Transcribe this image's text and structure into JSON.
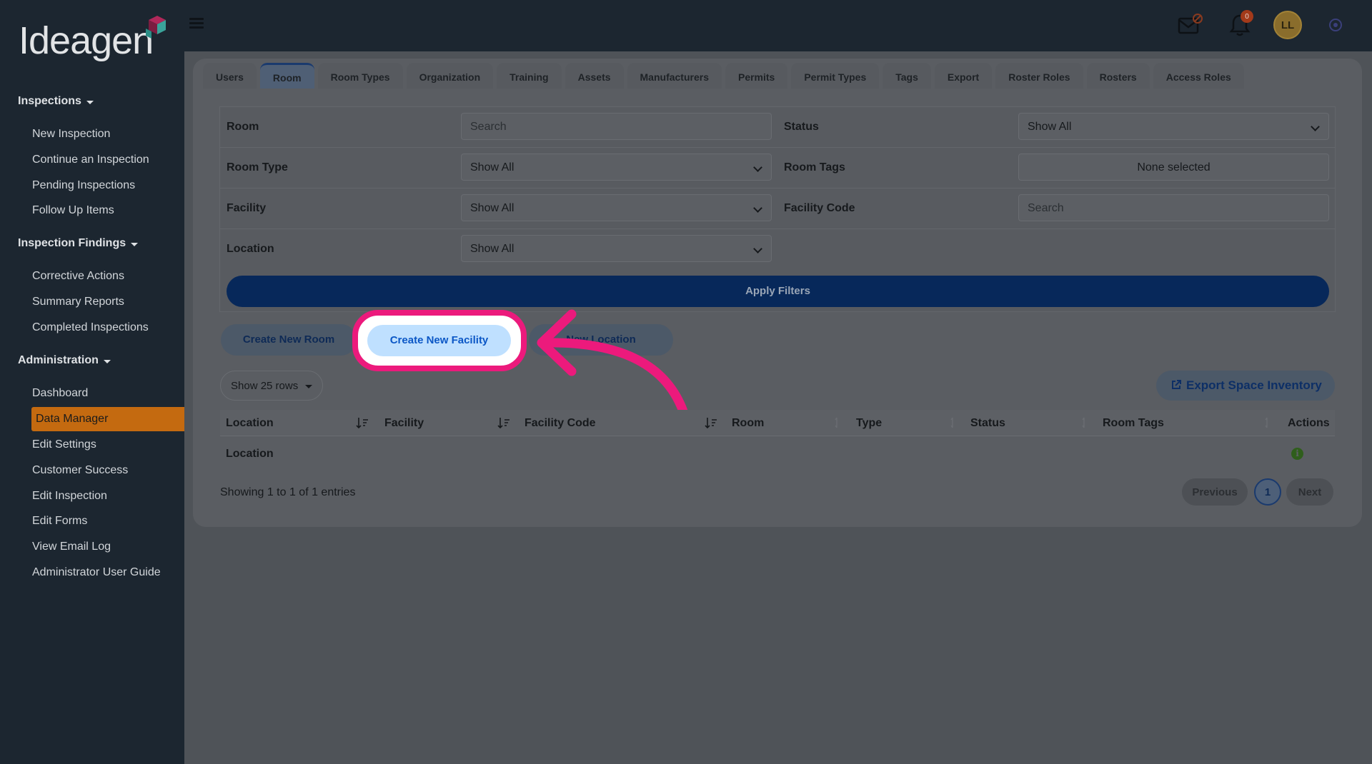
{
  "brand": {
    "logo_text": "Ideagen"
  },
  "sidebar": {
    "sections": [
      {
        "title": "Inspections",
        "items": [
          "New Inspection",
          "Continue an Inspection",
          "Pending Inspections",
          "Follow Up Items"
        ]
      },
      {
        "title": "Inspection Findings",
        "items": [
          "Corrective Actions",
          "Summary Reports",
          "Completed Inspections"
        ]
      },
      {
        "title": "Administration",
        "items": [
          "Dashboard",
          "Data Manager",
          "Edit Settings",
          "Customer Success",
          "Edit Inspection",
          "Edit Forms",
          "View Email Log",
          "Administrator User Guide"
        ]
      }
    ],
    "active_item": "Data Manager"
  },
  "topbar": {
    "notification_count": "0",
    "avatar_initials": "LL"
  },
  "tabs": [
    "Users",
    "Room",
    "Room Types",
    "Organization",
    "Training",
    "Assets",
    "Manufacturers",
    "Permits",
    "Permit Types",
    "Tags",
    "Export",
    "Roster Roles",
    "Rosters",
    "Access Roles"
  ],
  "active_tab": "Room",
  "filters": {
    "room": {
      "label": "Room",
      "placeholder": "Search"
    },
    "status": {
      "label": "Status",
      "value": "Show All"
    },
    "room_type": {
      "label": "Room Type",
      "value": "Show All"
    },
    "room_tags": {
      "label": "Room Tags",
      "value": "None selected"
    },
    "facility": {
      "label": "Facility",
      "value": "Show All"
    },
    "facility_code": {
      "label": "Facility Code",
      "placeholder": "Search"
    },
    "location": {
      "label": "Location",
      "value": "Show All"
    },
    "apply_label": "Apply Filters"
  },
  "actions": {
    "create_room": "Create New Room",
    "create_facility": "Create New Facility",
    "new_location": "New Location",
    "show_rows": "Show 25 rows",
    "export": "Export Space Inventory"
  },
  "table": {
    "columns": [
      "Location",
      "Facility",
      "Facility Code",
      "Room",
      "Type",
      "Status",
      "Room Tags",
      "Actions"
    ],
    "rows": [
      {
        "location": "Location"
      }
    ],
    "entries_text": "Showing 1 to 1 of 1 entries"
  },
  "pagination": {
    "previous": "Previous",
    "current": "1",
    "next": "Next"
  },
  "colors": {
    "highlight": "#ec1a7c",
    "active_nav": "#c46a10",
    "apply": "#07285a"
  }
}
